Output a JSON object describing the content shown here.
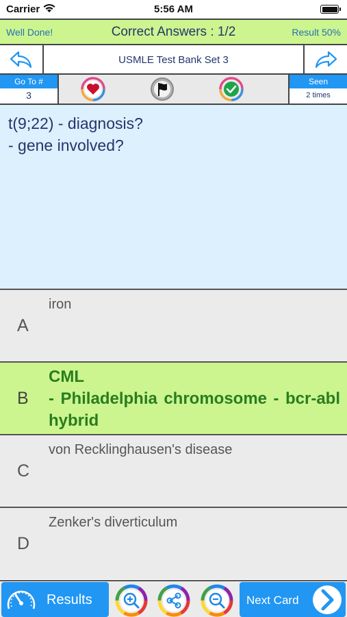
{
  "status_bar": {
    "carrier": "Carrier",
    "time": "5:56 AM"
  },
  "score": {
    "well_done": "Well Done!",
    "correct_answers": "Correct Answers : 1/2",
    "result": "Result 50%"
  },
  "nav": {
    "title": "USMLE Test Bank Set 3",
    "back_icon": "back-arrow-icon",
    "forward_icon": "forward-arrow-icon"
  },
  "toolbar": {
    "goto_label": "Go To #",
    "goto_value": "3",
    "seen_label": "Seen",
    "seen_value": "2 times",
    "icons": [
      "heart-favorite-icon",
      "flag-icon",
      "checkmark-icon"
    ]
  },
  "question": {
    "line1": "t(9;22) - diagnosis?",
    "line2": "- gene involved?"
  },
  "answers": [
    {
      "letter": "A",
      "text": "iron",
      "correct": false
    },
    {
      "letter": "B",
      "text": "CML\n- Philadelphia chromosome - bcr-abl hybrid",
      "correct": true
    },
    {
      "letter": "C",
      "text": "von Recklinghausen's disease",
      "correct": false
    },
    {
      "letter": "D",
      "text": "Zenker's diverticulum",
      "correct": false
    }
  ],
  "bottom": {
    "results_label": "Results",
    "next_label": "Next Card",
    "icons": [
      "zoom-in-icon",
      "share-icon",
      "zoom-out-icon"
    ]
  },
  "colors": {
    "accent_blue": "#2196f3",
    "correct_green": "#ccf58f",
    "question_bg": "#dcf0fd",
    "answer_bg": "#ebebeb",
    "text_navy": "#24356b",
    "correct_text": "#2a7d1f"
  }
}
